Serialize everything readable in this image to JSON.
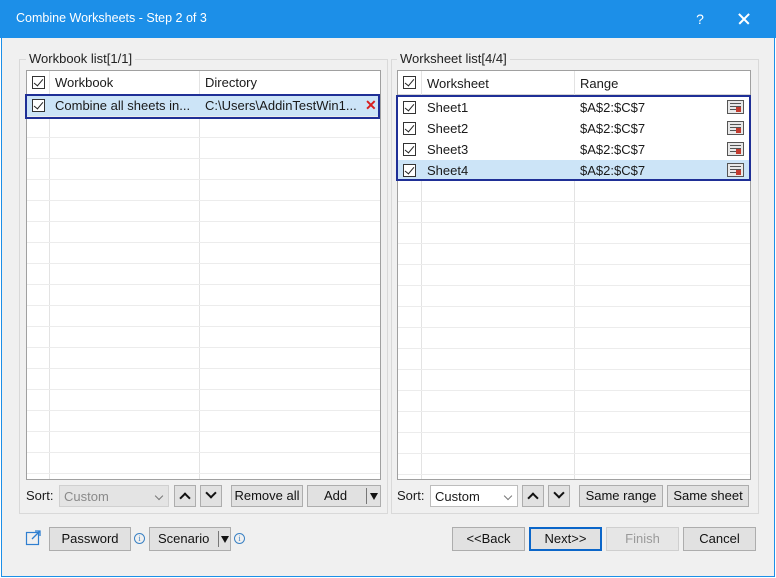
{
  "window": {
    "title": "Combine Worksheets - Step 2 of 3",
    "help_label": "?"
  },
  "workbook_panel": {
    "label": "Workbook list[1/1]",
    "columns": [
      "Workbook",
      "Directory"
    ],
    "rows": [
      {
        "name": "Combine all sheets in...",
        "directory": "C:\\Users\\AddinTestWin1...",
        "checked": true
      }
    ],
    "sort_label": "Sort:",
    "sort_value": "Custom",
    "remove_all_label": "Remove all",
    "add_label": "Add"
  },
  "worksheet_panel": {
    "label": "Worksheet list[4/4]",
    "columns": [
      "Worksheet",
      "Range"
    ],
    "rows": [
      {
        "name": "Sheet1",
        "range": "$A$2:$C$7",
        "checked": true
      },
      {
        "name": "Sheet2",
        "range": "$A$2:$C$7",
        "checked": true
      },
      {
        "name": "Sheet3",
        "range": "$A$2:$C$7",
        "checked": true
      },
      {
        "name": "Sheet4",
        "range": "$A$2:$C$7",
        "checked": true
      }
    ],
    "sort_label": "Sort:",
    "sort_value": "Custom",
    "same_range_label": "Same range",
    "same_sheet_label": "Same sheet"
  },
  "footer": {
    "password_label": "Password",
    "scenario_label": "Scenario",
    "back_label": "<<Back",
    "next_label": "Next>>",
    "finish_label": "Finish",
    "cancel_label": "Cancel",
    "info_glyph": "i"
  },
  "colors": {
    "titlebar": "#1c8fe8",
    "selection_outline": "#1f2f96",
    "selected_row": "#cce4f7",
    "remove_x": "#d81e1e"
  },
  "icons": {
    "help": "question-mark-icon",
    "close": "close-icon",
    "remove": "remove-x-icon",
    "range_picker": "range-picker-icon",
    "external": "external-link-icon",
    "info": "info-icon"
  }
}
